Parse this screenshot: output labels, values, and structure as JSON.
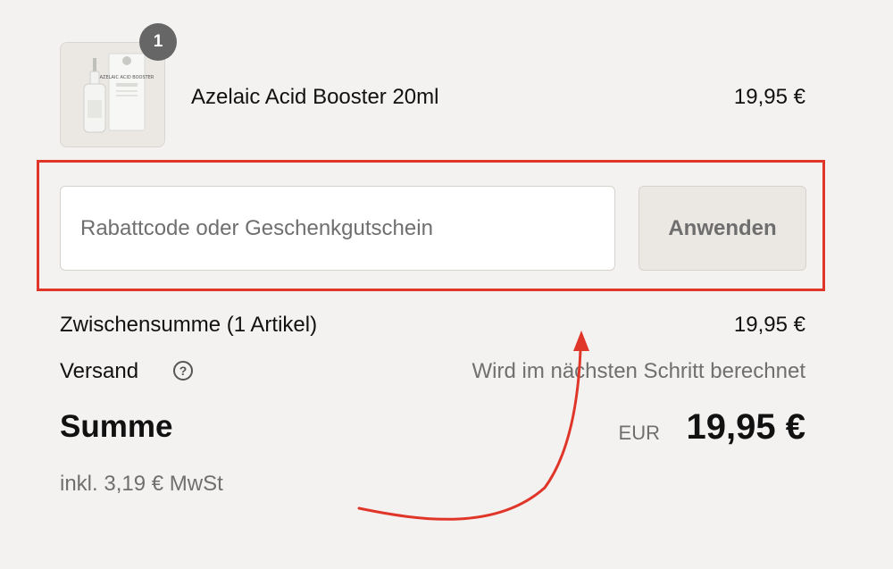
{
  "cart": {
    "item": {
      "name": "Azelaic Acid Booster 20ml",
      "price": "19,95 €",
      "quantity": "1",
      "package_text": "AZELAIC ACID BOOSTER"
    }
  },
  "discount": {
    "placeholder": "Rabattcode oder Geschenkgutschein",
    "value": "",
    "apply_label": "Anwenden"
  },
  "summary": {
    "subtotal_label": "Zwischensumme (1 Artikel)",
    "subtotal_value": "19,95 €",
    "shipping_label": "Versand",
    "shipping_info_icon": "?",
    "shipping_value": "Wird im nächsten Schritt berechnet",
    "total_label": "Summe",
    "total_currency": "EUR",
    "total_value": "19,95 €",
    "tax_note": "inkl. 3,19 € MwSt"
  },
  "annotation": {
    "color": "#e0362a"
  }
}
